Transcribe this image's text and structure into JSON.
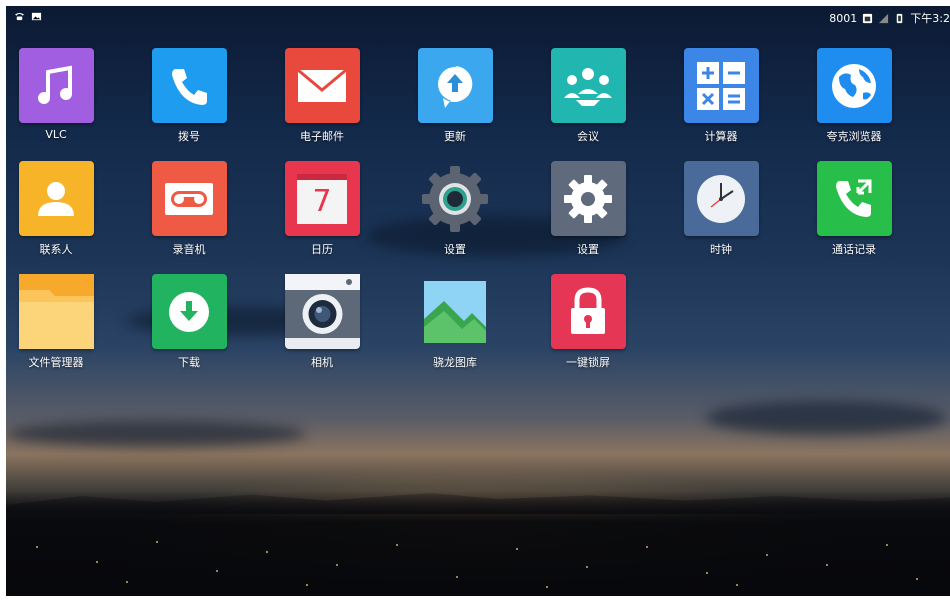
{
  "status_bar": {
    "left_icons": [
      "phone-icon",
      "image-icon"
    ],
    "network_label": "8001",
    "time": "下午3:2"
  },
  "apps": [
    {
      "label": "VLC",
      "icon": "music-note-icon",
      "color": "#a25ee0"
    },
    {
      "label": "拨号",
      "icon": "phone-icon",
      "color": "#1e9cf0"
    },
    {
      "label": "电子邮件",
      "icon": "envelope-icon",
      "color": "#e8493c"
    },
    {
      "label": "更新",
      "icon": "update-arrow-icon",
      "color": "#3aa7ef"
    },
    {
      "label": "会议",
      "icon": "meeting-people-icon",
      "color": "#22b6b0"
    },
    {
      "label": "计算器",
      "icon": "calculator-icon",
      "color": "#3b86e6"
    },
    {
      "label": "夸克浏览器",
      "icon": "globe-icon",
      "color": "#1f8df0"
    },
    {
      "label": "联系人",
      "icon": "contact-person-icon",
      "color": "#f7b429"
    },
    {
      "label": "录音机",
      "icon": "cassette-icon",
      "color": "#ee5a44"
    },
    {
      "label": "日历",
      "icon": "calendar-icon",
      "color": "#e8364e",
      "calendar_day": "7"
    },
    {
      "label": "设置",
      "icon": "gear-icon",
      "color": ""
    },
    {
      "label": "设置",
      "icon": "gear-icon",
      "color": "#5f6b7d"
    },
    {
      "label": "时钟",
      "icon": "clock-icon",
      "color": "#4a6b9a"
    },
    {
      "label": "通话记录",
      "icon": "call-log-icon",
      "color": "#27bf4a"
    },
    {
      "label": "文件管理器",
      "icon": "folder-icon",
      "color": "#f6b03c"
    },
    {
      "label": "下载",
      "icon": "download-icon",
      "color": "#21b35f"
    },
    {
      "label": "相机",
      "icon": "camera-icon",
      "color": "#e9edf2"
    },
    {
      "label": "骁龙图库",
      "icon": "gallery-icon",
      "color": "#6cc3f0"
    },
    {
      "label": "一键锁屏",
      "icon": "lock-icon",
      "color": "#e53656"
    }
  ]
}
